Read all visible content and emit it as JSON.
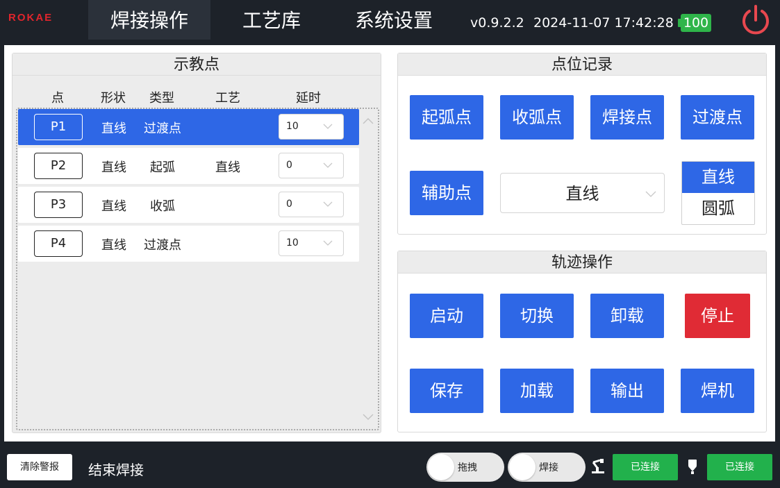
{
  "header": {
    "logo": "ROKAE",
    "tabs": [
      {
        "label": "焊接操作"
      },
      {
        "label": "工艺库"
      },
      {
        "label": "系统设置"
      }
    ],
    "version": "v0.9.2.2",
    "datetime": "2024-11-07 17:42:28",
    "battery": "100"
  },
  "teach_panel": {
    "title": "示教点",
    "columns": {
      "point": "点",
      "shape": "形状",
      "type": "类型",
      "process": "工艺",
      "delay": "延时"
    },
    "rows": [
      {
        "id": "P1",
        "shape": "直线",
        "type": "过渡点",
        "process": "",
        "delay": "10"
      },
      {
        "id": "P2",
        "shape": "直线",
        "type": "起弧",
        "process": "直线",
        "delay": "0"
      },
      {
        "id": "P3",
        "shape": "直线",
        "type": "收弧",
        "process": "",
        "delay": "0"
      },
      {
        "id": "P4",
        "shape": "直线",
        "type": "过渡点",
        "process": "",
        "delay": "10"
      }
    ],
    "selected_row": "P1"
  },
  "record_panel": {
    "title": "点位记录",
    "buttons": {
      "arc_start": "起弧点",
      "arc_end": "收弧点",
      "weld_point": "焊接点",
      "transition_point": "过渡点",
      "aux_point": "辅助点"
    },
    "shape_select": "直线",
    "segment": {
      "line": "直线",
      "arc": "圆弧",
      "selected": "直线"
    }
  },
  "trajectory_panel": {
    "title": "轨迹操作",
    "buttons": {
      "start": "启动",
      "switch": "切换",
      "unload": "卸载",
      "stop": "停止",
      "save": "保存",
      "load": "加载",
      "export": "输出",
      "welder": "焊机"
    }
  },
  "footer": {
    "clear_alarm": "清除警报",
    "end_weld": "结束焊接",
    "drag_toggle": "拖拽",
    "weld_toggle": "焊接",
    "robot_status": "已连接",
    "welder_status": "已连接"
  },
  "colors": {
    "accent": "#2e67e6",
    "stop": "#e02b35",
    "connected": "#22b14c",
    "power": "#e8484f",
    "brand": "#e0252c"
  }
}
